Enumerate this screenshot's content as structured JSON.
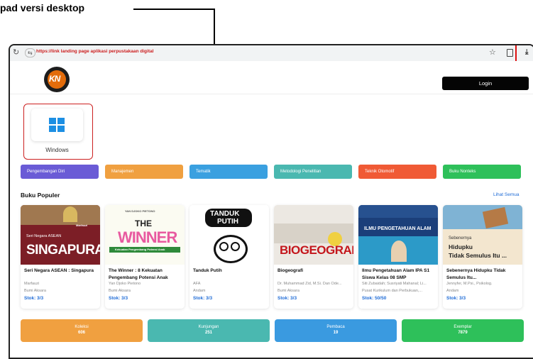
{
  "annotation": {
    "label": "pad versi desktop"
  },
  "browser": {
    "url": "https://link landing page aplikasi perpustakaan digital",
    "highlight_color": "#d11111"
  },
  "navbar": {
    "logo_text": "KN",
    "login_label": "Login"
  },
  "download": {
    "platform_label": "Windows"
  },
  "categories": [
    {
      "label": "Pengembangan Diri",
      "color": "#6a5bd6"
    },
    {
      "label": "Manajemen",
      "color": "#f0a040"
    },
    {
      "label": "Tematik",
      "color": "#3aa0e0"
    },
    {
      "label": "Metodologi Penelitian",
      "color": "#4ab8b0"
    },
    {
      "label": "Teknik Otomotif",
      "color": "#f05a35"
    },
    {
      "label": "Buku Nonteks",
      "color": "#2ec05a"
    }
  ],
  "popular": {
    "title": "Buku Populer",
    "see_all": "Lihat Semua",
    "books": [
      {
        "title": "Seri Negara ASEAN : Singapura",
        "author": "Marfauzi",
        "publisher": "Bumi Aksara",
        "stock": "Stok: 3/3",
        "cover": {
          "small": "Seri Negara ASEAN",
          "big": "SINGAPURA",
          "tag": "Marfauzi"
        }
      },
      {
        "title": "The Winner : 8 Kekuatan Pengembang Potensi Anak",
        "author": "Yan Djoko Pietono",
        "publisher": "Bumi Aksara",
        "stock": "Stok: 3/3",
        "cover": {
          "top": "YAN DJOKO PIETONO",
          "the": "THE",
          "big": "WINNER",
          "sub": "Kekuatan Pengembang Potensi Anak"
        }
      },
      {
        "title": "Tanduk Putih",
        "author": "AFA",
        "publisher": "Andam",
        "stock": "Stok: 3/3",
        "cover": {
          "l1": "TANDUK",
          "l2": "PUTIH"
        }
      },
      {
        "title": "Biogeografi",
        "author": "Dr. Muhammad Zid, M.Si. Dan Ode...",
        "publisher": "Bumi Aksara",
        "stock": "Stok: 3/3",
        "cover": {
          "big": "BIOGEOGRAFI"
        }
      },
      {
        "title": "Ilmu Pengetahuan Alam IPA S1 Siswa Kelas 08 SMP",
        "author": "Siti Zubaidah; Susriyati Mahanal; Li...",
        "publisher": "Pusat Kurikulum dan Perbukuan,...",
        "stock": "Stok: 50/50",
        "cover": {
          "band": "ILMU PENGETAHUAN ALAM"
        }
      },
      {
        "title": "Sebenernya Hidupku Tidak Semulus Itu...",
        "author": "Jennyfer, M.Psi., Psikolog.",
        "publisher": "Andam",
        "stock": "Stok: 3/3",
        "cover": {
          "l1": "Sebenernya",
          "l2": "Hidupku",
          "l3": "Tidak Semulus Itu ..."
        }
      }
    ]
  },
  "stats": [
    {
      "label": "Koleksi",
      "value": "606",
      "color": "#f0a040"
    },
    {
      "label": "Kunjungan",
      "value": "251",
      "color": "#4ab8b0"
    },
    {
      "label": "Pembaca",
      "value": "19",
      "color": "#3a9ae0"
    },
    {
      "label": "Exemplar",
      "value": "7879",
      "color": "#2ec05a"
    }
  ]
}
